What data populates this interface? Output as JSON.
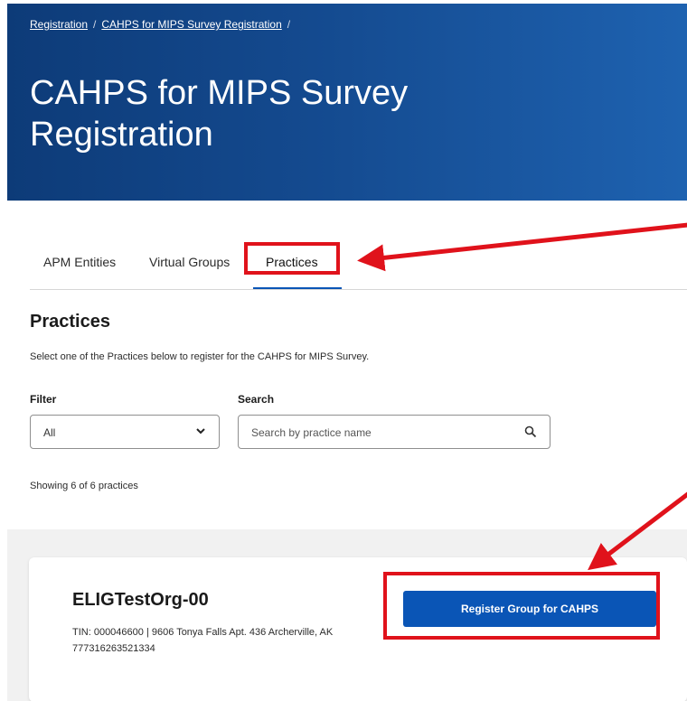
{
  "breadcrumb": {
    "items": [
      "Registration",
      "CAHPS for MIPS Survey Registration"
    ],
    "separator": "/"
  },
  "page": {
    "title": "CAHPS for MIPS Survey Registration"
  },
  "tabs": {
    "items": [
      "APM Entities",
      "Virtual Groups",
      "Practices"
    ],
    "active": "Practices"
  },
  "section": {
    "title": "Practices",
    "description": "Select one of the Practices below to register for the CAHPS for MIPS Survey."
  },
  "filter": {
    "label": "Filter",
    "value": "All"
  },
  "search": {
    "label": "Search",
    "placeholder": "Search by practice name"
  },
  "results": {
    "showing": "Showing 6 of 6 practices"
  },
  "practices": [
    {
      "name": "ELIGTestOrg-00",
      "meta": "TIN: 000046600 | 9606 Tonya Falls Apt. 436 Archerville, AK 777316263521334",
      "button": "Register Group for CAHPS"
    }
  ],
  "colors": {
    "hero": "#144a8f",
    "accent": "#0a55b6",
    "annotation": "#e0121b"
  },
  "icons": [
    "chevron-down-icon",
    "search-icon"
  ]
}
